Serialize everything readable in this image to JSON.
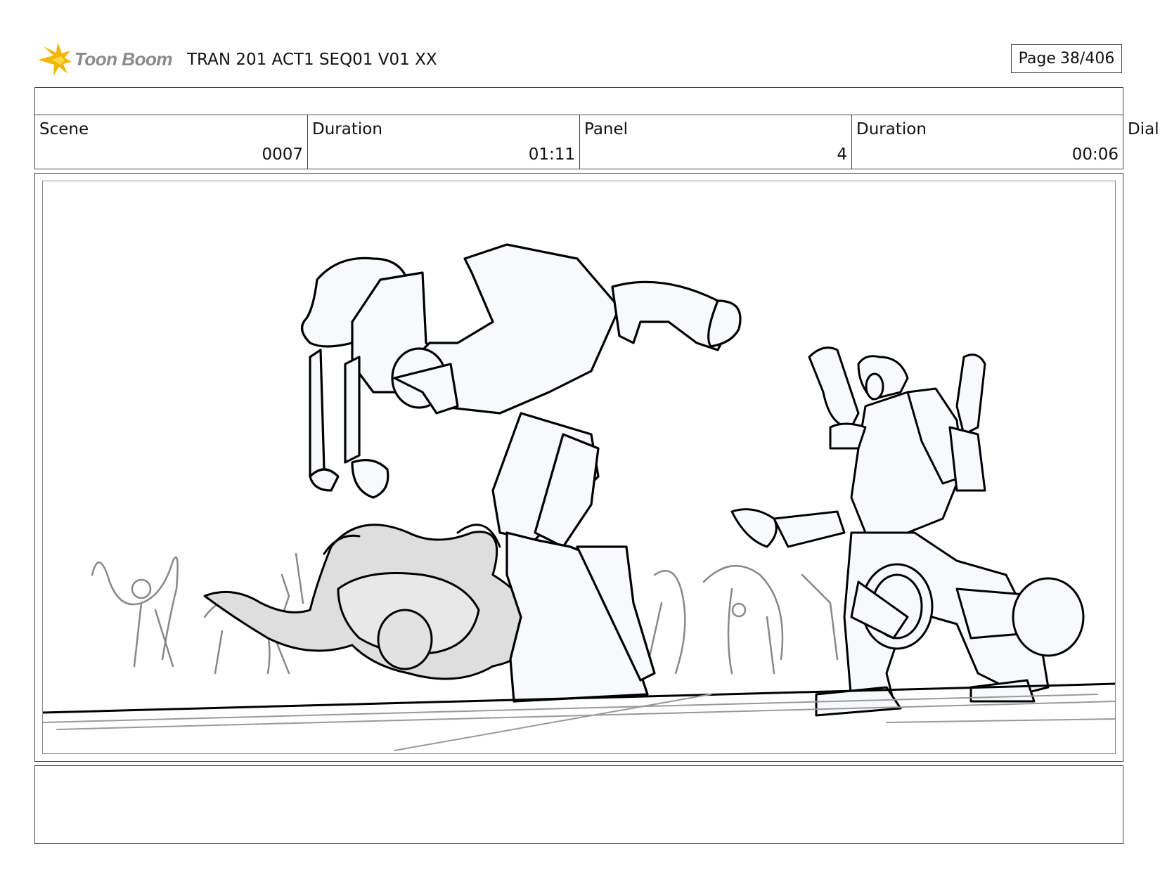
{
  "header": {
    "brand": "Toon Boom",
    "title": "TRAN 201 ACT1 SEQ01 V01 XX",
    "page_label": "Page",
    "page_number": "38/406"
  },
  "panel_info": {
    "scene_label": "Scene",
    "scene_value": "0007",
    "scene_duration_label": "Duration",
    "scene_duration_value": "01:11",
    "panel_label": "Panel",
    "panel_value": "4",
    "panel_duration_label": "Duration",
    "panel_duration_value": "00:06",
    "dialog_label_partial": "Dialo"
  },
  "colors": {
    "logo_flame": "#f2b705",
    "logo_text": "#8a8a8a",
    "border": "#444444",
    "shade_fill": "#dedede"
  },
  "icons": {
    "logo": "toon-boom-flame-icon"
  }
}
